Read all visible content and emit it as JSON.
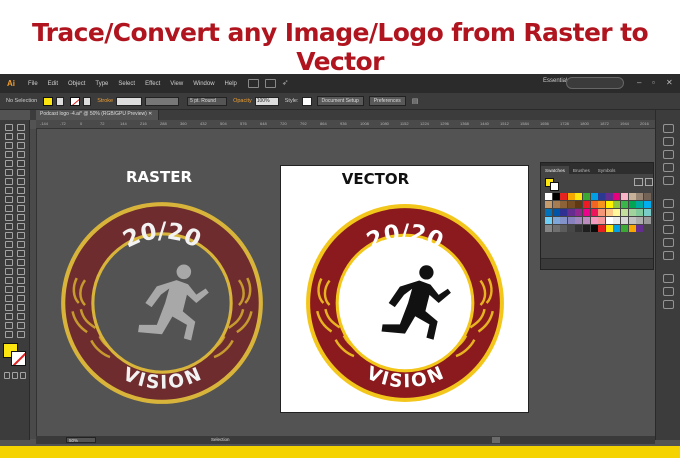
{
  "banner": {
    "title": "Trace/Convert any Image/Logo from Raster to Vector"
  },
  "app": {
    "logo_text": "Ai",
    "menu": [
      "File",
      "Edit",
      "Object",
      "Type",
      "Select",
      "Effect",
      "View",
      "Window",
      "Help"
    ],
    "workspace": "Essentials",
    "control": {
      "selection": "No Selection",
      "stroke_label": "Stroke",
      "brush": "5 pt. Round",
      "opacity_label": "Opacity",
      "opacity_value": "100%",
      "style_label": "Style:",
      "document_setup": "Document Setup",
      "preferences": "Preferences"
    },
    "document_tab": "Podcast logo -4.ai* @ 50% (RGB/GPU Preview)",
    "ruler_ticks": [
      "-144",
      "-72",
      "0",
      "72",
      "144",
      "216",
      "288",
      "360",
      "432",
      "504",
      "576",
      "648",
      "720",
      "792",
      "864",
      "936",
      "1008",
      "1080",
      "1152",
      "1224",
      "1296",
      "1368",
      "1440",
      "1512",
      "1584",
      "1656",
      "1728",
      "1800",
      "1872",
      "1944",
      "2016"
    ],
    "status": {
      "zoom": "50%",
      "tool": "Selection"
    },
    "colors": {
      "fill": "#fde510",
      "accent_orange": "#f0a030"
    }
  },
  "swatches_panel": {
    "tabs": [
      "Swatches",
      "Brushes",
      "Symbols"
    ],
    "colors": [
      "#ffffff",
      "#000000",
      "#e52421",
      "#f7a800",
      "#fde510",
      "#3aaa35",
      "#00a0e3",
      "#2b3990",
      "#662d91",
      "#e6007e",
      "#f9b4c8",
      "#c7b299",
      "#998675",
      "#736357",
      "#c69c6d",
      "#a67c52",
      "#8c6239",
      "#754c24",
      "#603813",
      "#ed1c24",
      "#f26522",
      "#f7941d",
      "#fff200",
      "#8dc63f",
      "#39b54a",
      "#00a651",
      "#00a99d",
      "#00aeef",
      "#0072bc",
      "#0054a6",
      "#2e3192",
      "#662d91",
      "#92278f",
      "#ec008c",
      "#ed145b",
      "#f69679",
      "#fdc689",
      "#fff799",
      "#c4df9b",
      "#a3d39c",
      "#82ca9c",
      "#7accc8",
      "#6dcff6",
      "#7da7d9",
      "#8393ca",
      "#8781bd",
      "#a186be",
      "#bd8cbf",
      "#f49ac1",
      "#f5989d",
      "#ffffff",
      "#ebebeb",
      "#d7d7d7",
      "#c2c2c2",
      "#adadad",
      "#999999",
      "#858585",
      "#707070",
      "#5c5c5c",
      "#474747",
      "#333333",
      "#1f1f1f",
      "#0a0a0a",
      "#e52421",
      "#fde510",
      "#00a0e3",
      "#3aaa35",
      "#f7a800",
      "#662d91"
    ]
  },
  "raster": {
    "label": "RASTER",
    "top_text": "20/20",
    "bottom_text": "VISION"
  },
  "vector": {
    "label": "VECTOR",
    "top_text": "20/20",
    "bottom_text": "VISION"
  }
}
